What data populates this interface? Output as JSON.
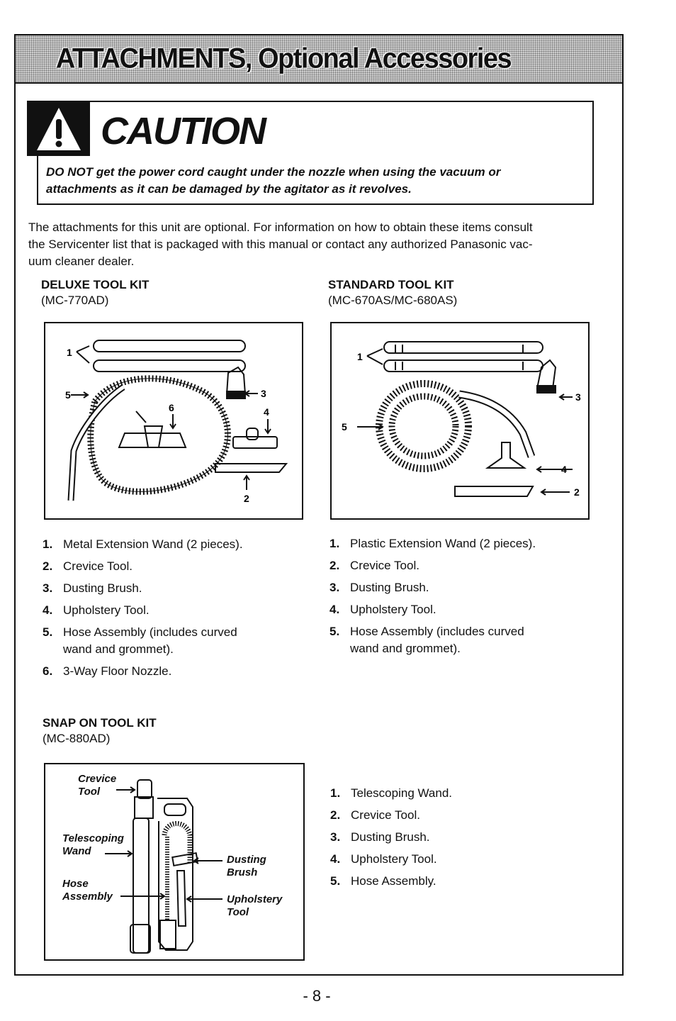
{
  "header": {
    "title": "ATTACHMENTS, Optional Accessories"
  },
  "caution": {
    "icon": "warning-triangle-icon",
    "heading": "CAUTION",
    "line1": "DO NOT get the power cord caught under the nozzle when using the vacuum or",
    "line2": "attachments as it can be damaged by the agitator as it revolves."
  },
  "intro": {
    "line1": "The attachments for this unit are optional.  For information on how to obtain these items consult",
    "line2": "the Servicenter list that is packaged with this manual or contact any authorized Panasonic vac-",
    "line3": "uum cleaner dealer."
  },
  "kits": {
    "deluxe": {
      "name": "DELUXE TOOL KIT",
      "model": "(MC-770AD)",
      "callouts": [
        "1",
        "2",
        "3",
        "4",
        "5",
        "6"
      ],
      "items": [
        {
          "num": "1.",
          "text": "Metal Extension Wand (2 pieces)."
        },
        {
          "num": "2.",
          "text": "Crevice Tool."
        },
        {
          "num": "3.",
          "text": "Dusting Brush."
        },
        {
          "num": "4.",
          "text": "Upholstery Tool."
        },
        {
          "num": "5.",
          "text": "Hose Assembly (includes curved",
          "text2": "wand and grommet)."
        },
        {
          "num": "6.",
          "text": "3-Way Floor Nozzle."
        }
      ]
    },
    "standard": {
      "name": "STANDARD TOOL KIT",
      "model": "(MC-670AS/MC-680AS)",
      "callouts": [
        "1",
        "2",
        "3",
        "4",
        "5"
      ],
      "items": [
        {
          "num": "1.",
          "text": "Plastic Extension Wand (2 pieces)."
        },
        {
          "num": "2.",
          "text": "Crevice Tool."
        },
        {
          "num": "3.",
          "text": "Dusting Brush."
        },
        {
          "num": "4.",
          "text": "Upholstery Tool."
        },
        {
          "num": "5.",
          "text": "Hose Assembly (includes curved",
          "text2": "wand and grommet)."
        }
      ]
    },
    "snapon": {
      "name": "SNAP ON TOOL KIT",
      "model": "(MC-880AD)",
      "callouts": {
        "crevice": [
          "Crevice",
          "Tool"
        ],
        "telescoping": [
          "Telescoping",
          "Wand"
        ],
        "hose": [
          "Hose",
          "Assembly"
        ],
        "dusting": [
          "Dusting",
          "Brush"
        ],
        "upholstery": [
          "Upholstery",
          "Tool"
        ]
      },
      "items": [
        {
          "num": "1.",
          "text": "Telescoping Wand."
        },
        {
          "num": "2.",
          "text": "Crevice Tool."
        },
        {
          "num": "3.",
          "text": "Dusting Brush."
        },
        {
          "num": "4.",
          "text": "Upholstery Tool."
        },
        {
          "num": "5.",
          "text": "Hose Assembly."
        }
      ]
    }
  },
  "footer": {
    "page_number": "- 8 -"
  }
}
